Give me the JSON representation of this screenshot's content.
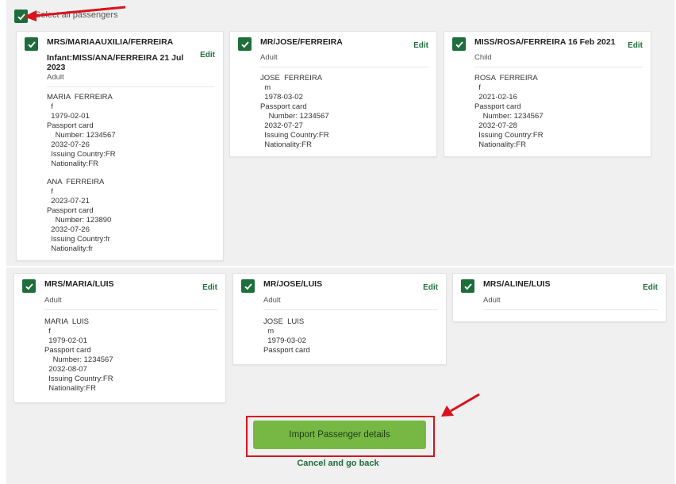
{
  "select_all_label": "Select all passengers",
  "edit_label": "Edit",
  "import_button_label": "Import Passenger details",
  "cancel_link_label": "Cancel and go back",
  "colors": {
    "check_green": "#1e6e3c",
    "button_green": "#76b843",
    "annotation_red": "#d8131d"
  },
  "cards": [
    {
      "title": "MRS/MARIAAUXILIA/FERREIRA",
      "subtitle_line1": "Infant:MISS/ANA/FERREIRA 21 Jul",
      "subtitle_line2": "2023",
      "type": "Adult",
      "passengers": [
        {
          "name": "MARIA  FERREIRA",
          "gender": "f",
          "dob": "1979-02-01",
          "doc": "Passport card",
          "number": "Number: 1234567",
          "expiry": "2032-07-26",
          "issuing": "Issuing Country:FR",
          "nationality": "Nationality:FR"
        },
        {
          "name": "ANA  FERREIRA",
          "gender": "f",
          "dob": "2023-07-21",
          "doc": "Passport card",
          "number": "Number: 123890",
          "expiry": "2032-07-26",
          "issuing": "Issuing Country:fr",
          "nationality": "Nationality:fr"
        }
      ]
    },
    {
      "title": "MR/JOSE/FERREIRA",
      "type": "Adult",
      "passengers": [
        {
          "name": "JOSE  FERREIRA",
          "gender": "m",
          "dob": "1978-03-02",
          "doc": "Passport card",
          "number": "Number: 1234567",
          "expiry": "2032-07-27",
          "issuing": "Issuing Country:FR",
          "nationality": "Nationality:FR"
        }
      ]
    },
    {
      "title": "MISS/ROSA/FERREIRA 16 Feb 2021",
      "type": "Child",
      "passengers": [
        {
          "name": "ROSA  FERREIRA",
          "gender": "f",
          "dob": "2021-02-16",
          "doc": "Passport card",
          "number": "Number: 1234567",
          "expiry": "2032-07-28",
          "issuing": "Issuing Country:FR",
          "nationality": "Nationality:FR"
        }
      ]
    },
    {
      "title": "MRS/MARIA/LUIS",
      "type": "Adult",
      "passengers": [
        {
          "name": "MARIA  LUIS",
          "gender": "f",
          "dob": "1979-02-01",
          "doc": "Passport card",
          "number": "Number: 1234567",
          "expiry": "2032-08-07",
          "issuing": "Issuing Country:FR",
          "nationality": "Nationality:FR"
        }
      ]
    },
    {
      "title": "MR/JOSE/LUIS",
      "type": "Adult",
      "passengers": [
        {
          "name": "JOSE  LUIS",
          "gender": "m",
          "dob": "1979-03-02",
          "doc": "Passport card"
        }
      ]
    },
    {
      "title": "MRS/ALINE/LUIS",
      "type": "Adult",
      "passengers": []
    }
  ]
}
